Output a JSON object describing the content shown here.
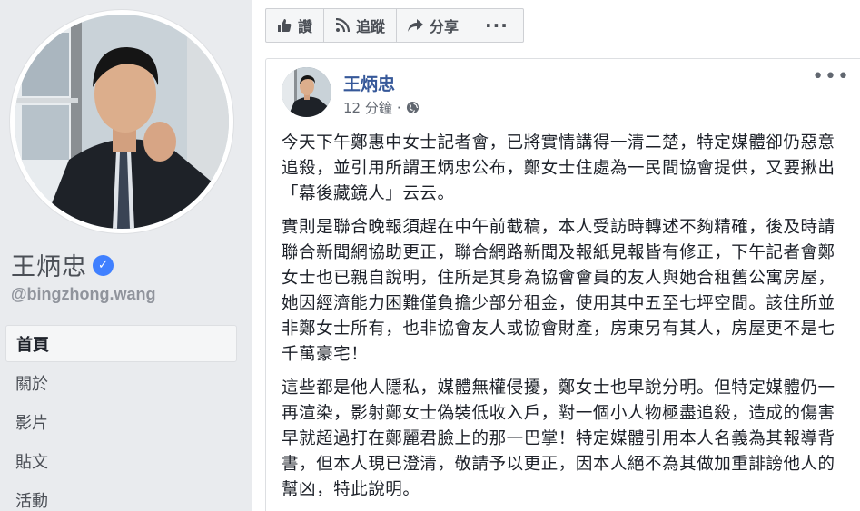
{
  "profile": {
    "name": "王炳忠",
    "handle": "@bingzhong.wang",
    "verified": true
  },
  "nav": {
    "items": [
      {
        "label": "首頁",
        "active": true
      },
      {
        "label": "關於",
        "active": false
      },
      {
        "label": "影片",
        "active": false
      },
      {
        "label": "貼文",
        "active": false
      },
      {
        "label": "活動",
        "active": false
      }
    ]
  },
  "actions": {
    "like": "讚",
    "follow": "追蹤",
    "share": "分享",
    "more": "···"
  },
  "post": {
    "author": "王炳忠",
    "time": "12 分鐘",
    "privacy_icon": "globe-icon",
    "menu": "•••",
    "paragraphs": [
      "今天下午鄭惠中女士記者會，已將實情講得一清二楚，特定媒體卻仍惡意追殺，並引用所謂王炳忠公布，鄭女士住處為一民間協會提供，又要揪出「幕後藏鏡人」云云。",
      "實則是聯合晚報須趕在中午前截稿，本人受訪時轉述不夠精確，後及時請聯合新聞網協助更正，聯合網路新聞及報紙見報皆有修正，下午記者會鄭女士也已親自說明，住所是其身為協會會員的友人與她合租舊公寓房屋，她因經濟能力困難僅負擔少部分租金，使用其中五至七坪空間。該住所並非鄭女士所有，也非協會友人或協會財產，房東另有其人，房屋更不是七千萬豪宅！",
      "這些都是他人隱私，媒體無權侵擾，鄭女士也早說分明。但特定媒體仍一再渲染，影射鄭女士偽裝低收入戶，對一個小人物極盡追殺，造成的傷害早就超過打在鄭麗君臉上的那一巴掌！特定媒體引用本人名義為其報導背書，但本人現已澄清，敬請予以更正，因本人絕不為其做加重誹謗他人的幫凶，特此說明。"
    ]
  },
  "colors": {
    "link": "#365899",
    "verified": "#4080ff",
    "background": "#e9ebee"
  }
}
